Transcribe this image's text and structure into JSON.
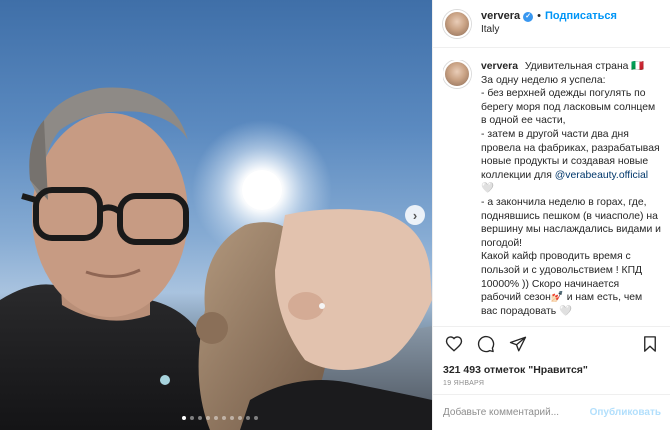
{
  "post": {
    "dots_count": 10,
    "active_dot": 0
  },
  "header": {
    "username": "ververa",
    "separator": "•",
    "follow_label": "Подписаться",
    "location": "Italy"
  },
  "caption": {
    "username": "ververa",
    "text_before_mention": "Удивительная страна 🇮🇹\nЗа одну неделю я успела:\n- без верхней одежды погулять по берегу моря под ласковым солнцем в одной ее части,\n- затем в другой части два дня провела на фабриках, разрабатывая новые продукты и создавая новые коллекции для ",
    "mention": "@verabeauty.official",
    "text_after_mention": " 🤍\n- а закончила неделю в горах, где, поднявшись пешком (в чиасполе) на вершину мы наслаждались видами и погодой!\nКакой кайф проводить время с пользой и с удовольствием ! КПД 10000% )) Скоро начинается рабочий сезон💅🏻 и нам есть, чем вас порадовать 🤍"
  },
  "actions": {
    "like": "heart-icon",
    "comment": "comment-icon",
    "share": "share-icon",
    "save": "bookmark-icon"
  },
  "likes_text": "321 493 отметок \"Нравится\"",
  "date": "19 ЯНВАРЯ",
  "comment_box": {
    "placeholder": "Добавьте комментарий...",
    "publish_label": "Опубликовать"
  },
  "colors": {
    "accent": "#0095f6",
    "publish_disabled": "#b2dffc",
    "verified": "#3897f0"
  }
}
